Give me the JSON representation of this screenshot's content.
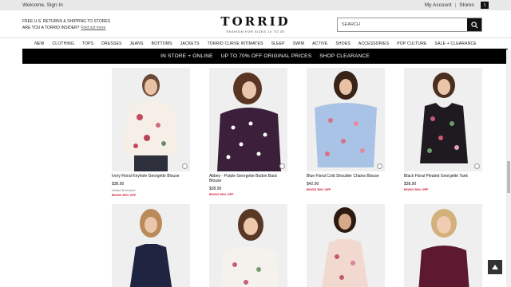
{
  "util_bar": {
    "welcome": "Welcome, Sign In",
    "my_account": "My Account",
    "separator": "|",
    "stores": "Stores",
    "bag_count": "1"
  },
  "header": {
    "promo_line1": "FREE U.S. RETURNS & SHIPPING TO STORES",
    "promo_line2": "ARE YOU A TORRID INSIDER?",
    "promo_link": "Find out more",
    "brand": "TORRID",
    "tagline": "FASHION FOR SIZES 10 TO 30",
    "search_placeholder": "SEARCH"
  },
  "nav": [
    "NEW",
    "CLOTHING",
    "TOPS",
    "DRESSES",
    "JEANS",
    "BOTTOMS",
    "JACKETS",
    "TORRID CURVE INTIMATES",
    "SLEEP",
    "SWIM",
    "ACTIVE",
    "SHOES",
    "ACCESSORIES",
    "POP CULTURE",
    "SALE + CLEARANCE"
  ],
  "banner": {
    "part1": "IN STORE + ONLINE",
    "part2": "UP TO 70% OFF ORIGINAL PRICES",
    "part3": "SHOP CLEARANCE"
  },
  "products": [
    {
      "name": "Ivory Floral Keyhole Georgette Blouse",
      "price": "$38.90",
      "note": "Online Exclusive",
      "promo": "BOGO 50% OFF"
    },
    {
      "name": "Abbey - Purple Georgette Button Back Blouse",
      "price": "$38.90",
      "note": "",
      "promo": "BOGO 50% OFF"
    },
    {
      "name": "Blue Floral Cold Shoulder Chains Blouse",
      "price": "$42.90",
      "note": "",
      "promo": "BOGO 50% OFF"
    },
    {
      "name": "Black Floral Pleated Georgette Tank",
      "price": "$38.90",
      "note": "",
      "promo": "BOGO 50% OFF"
    }
  ],
  "colors": {
    "black": "#000000",
    "promo_red": "#c8102e",
    "util_gray": "#e8e8e8"
  },
  "icons": {
    "search": "search-icon",
    "bag": "shopping-bag-icon",
    "back_to_top": "arrow-up-icon",
    "zoom": "zoom-icon"
  }
}
